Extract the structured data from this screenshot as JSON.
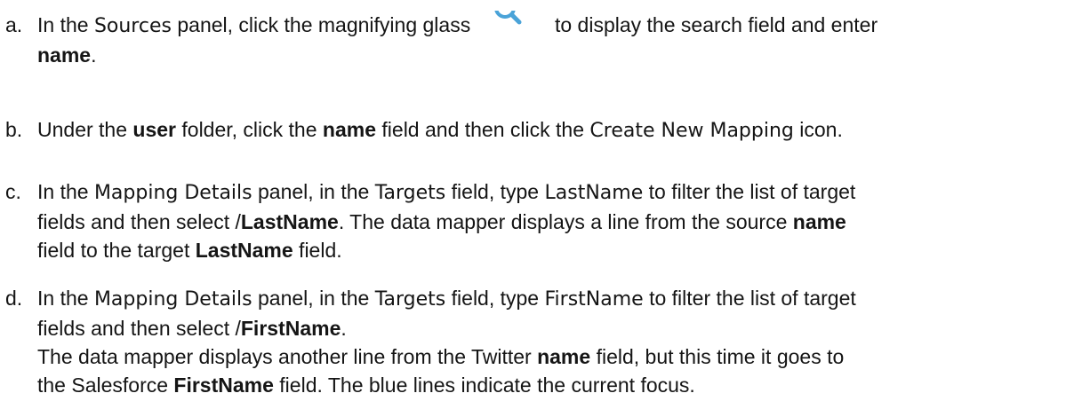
{
  "steps": [
    {
      "marker": "a.",
      "parts": [
        "In the ",
        "Sources",
        " panel, click the magnifying glass",
        "to display the search field and enter ",
        "name",
        "."
      ]
    },
    {
      "marker": "b.",
      "parts": [
        "Under the ",
        "user",
        " folder, click the ",
        "name",
        " field and then click the ",
        "Create New Mapping",
        " icon."
      ]
    },
    {
      "marker": "c.",
      "parts": [
        "In the ",
        "Mapping Details",
        " panel, in the ",
        "Targets",
        " field, type ",
        "LastName",
        " to filter the list of target",
        "fields and then select /",
        "LastName",
        ". The data mapper displays a line from the source ",
        "name",
        "field to the target ",
        "LastName",
        " field."
      ]
    },
    {
      "marker": "d.",
      "parts": [
        "In the ",
        "Mapping Details",
        " panel, in the ",
        "Targets",
        " field, type ",
        "FirstName",
        " to filter the list of target",
        "fields and then select /",
        "FirstName",
        ".",
        "The data mapper displays another line from the Twitter ",
        "name",
        " field, but this time it goes to",
        "the Salesforce ",
        "FirstName",
        " field. The blue lines indicate the current focus."
      ]
    }
  ],
  "icons": {
    "search": "search-icon",
    "accent": "#4aa3d8"
  }
}
